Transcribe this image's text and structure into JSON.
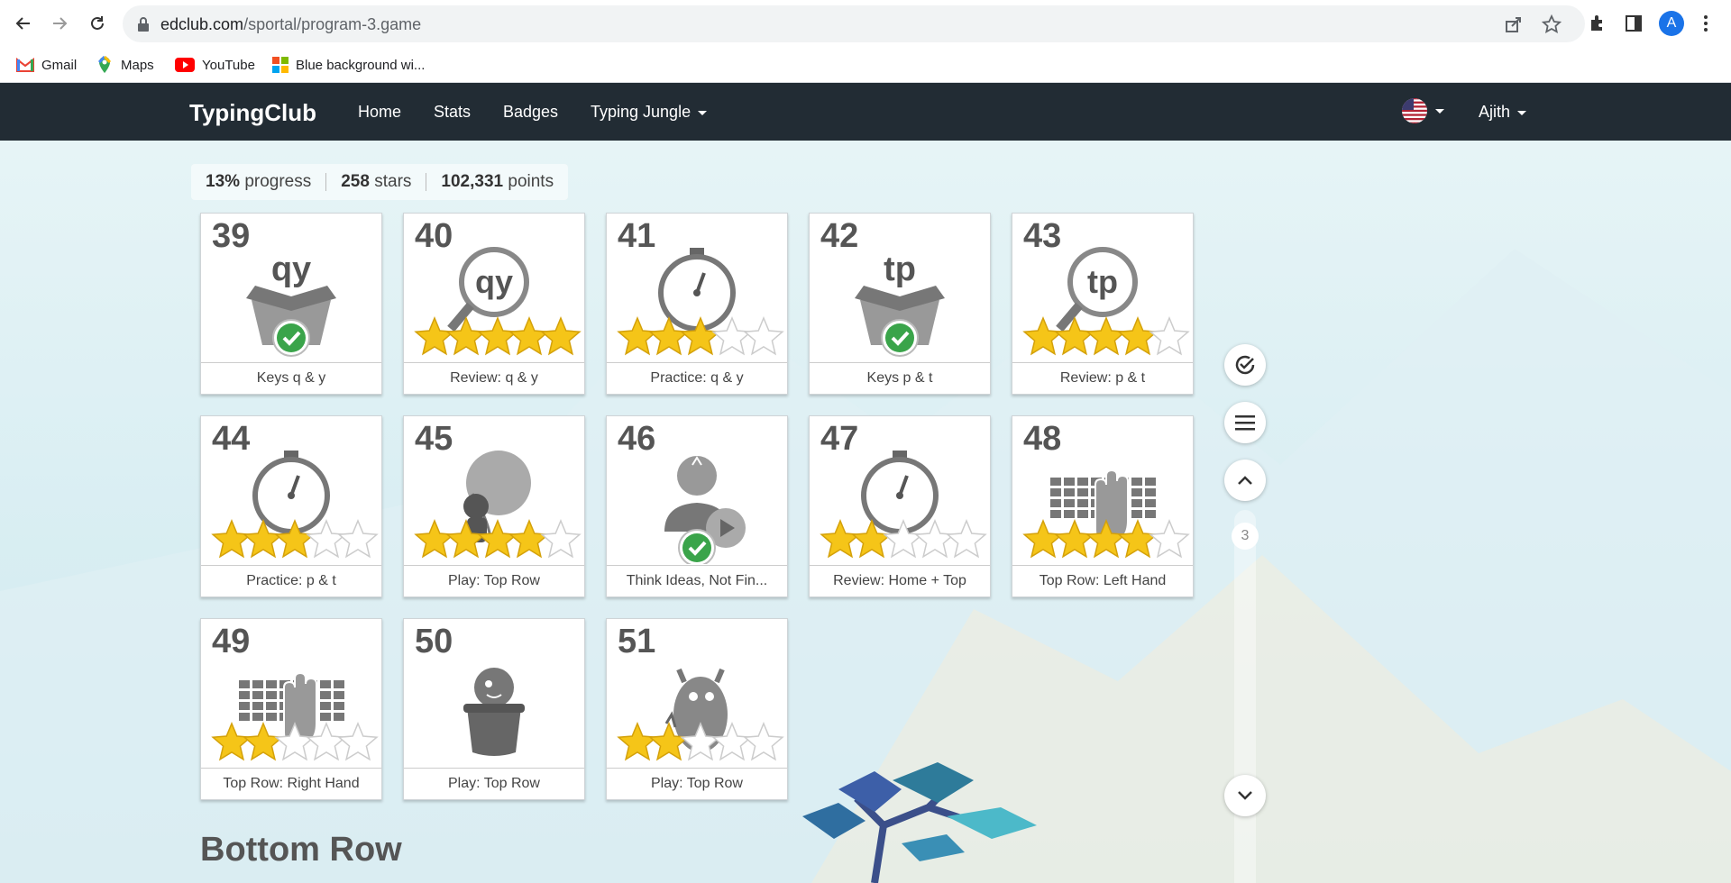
{
  "browser": {
    "url_host": "edclub.com",
    "url_path": "/sportal/program-3.game",
    "profile_initial": "A",
    "bookmarks": [
      {
        "label": "Gmail",
        "icon": "gmail-icon"
      },
      {
        "label": "Maps",
        "icon": "maps-icon"
      },
      {
        "label": "YouTube",
        "icon": "youtube-icon"
      },
      {
        "label": "Blue background wi...",
        "icon": "windows-icon"
      }
    ]
  },
  "header": {
    "brand": "TypingClub",
    "nav": [
      "Home",
      "Stats",
      "Badges",
      "Typing Jungle"
    ],
    "user": "Ajith"
  },
  "stats": {
    "progress_value": "13%",
    "progress_label": "progress",
    "stars_value": "258",
    "stars_label": "stars",
    "points_value": "102,331",
    "points_label": "points"
  },
  "lessons": [
    {
      "num": "39",
      "title": "Keys q & y",
      "art": "box",
      "keys": "qy",
      "stars": 0,
      "completed": true
    },
    {
      "num": "40",
      "title": "Review: q & y",
      "art": "magnifier",
      "keys": "qy",
      "stars": 5,
      "completed": false
    },
    {
      "num": "41",
      "title": "Practice: q & y",
      "art": "stopwatch",
      "keys": "",
      "stars": 3,
      "completed": false
    },
    {
      "num": "42",
      "title": "Keys p & t",
      "art": "box",
      "keys": "tp",
      "stars": 0,
      "completed": true
    },
    {
      "num": "43",
      "title": "Review: p & t",
      "art": "magnifier",
      "keys": "tp",
      "stars": 4,
      "completed": false
    },
    {
      "num": "44",
      "title": "Practice: p & t",
      "art": "stopwatch",
      "keys": "",
      "stars": 3,
      "completed": false
    },
    {
      "num": "45",
      "title": "Play: Top Row",
      "art": "balloon",
      "keys": "",
      "stars": 4,
      "completed": false
    },
    {
      "num": "46",
      "title": "Think Ideas, Not Fin...",
      "art": "idea",
      "keys": "",
      "stars": 0,
      "completed": true
    },
    {
      "num": "47",
      "title": "Review: Home + Top",
      "art": "stopwatch",
      "keys": "",
      "stars": 2,
      "completed": false
    },
    {
      "num": "48",
      "title": "Top Row: Left Hand",
      "art": "keyboard-hand",
      "keys": "",
      "stars": 4,
      "completed": false
    },
    {
      "num": "49",
      "title": "Top Row: Right Hand",
      "art": "keyboard-hand",
      "keys": "",
      "stars": 2,
      "completed": false
    },
    {
      "num": "50",
      "title": "Play: Top Row",
      "art": "pot-creature",
      "keys": "",
      "stars": 0,
      "completed": false
    },
    {
      "num": "51",
      "title": "Play: Top Row",
      "art": "monster",
      "keys": "",
      "stars": 2,
      "completed": false
    }
  ],
  "side_controls": {
    "page_indicator": "3"
  },
  "next_section": "Bottom Row",
  "colors": {
    "header_bg": "#222c34",
    "star_gold": "#f5c518",
    "check_green": "#3aa44a"
  }
}
